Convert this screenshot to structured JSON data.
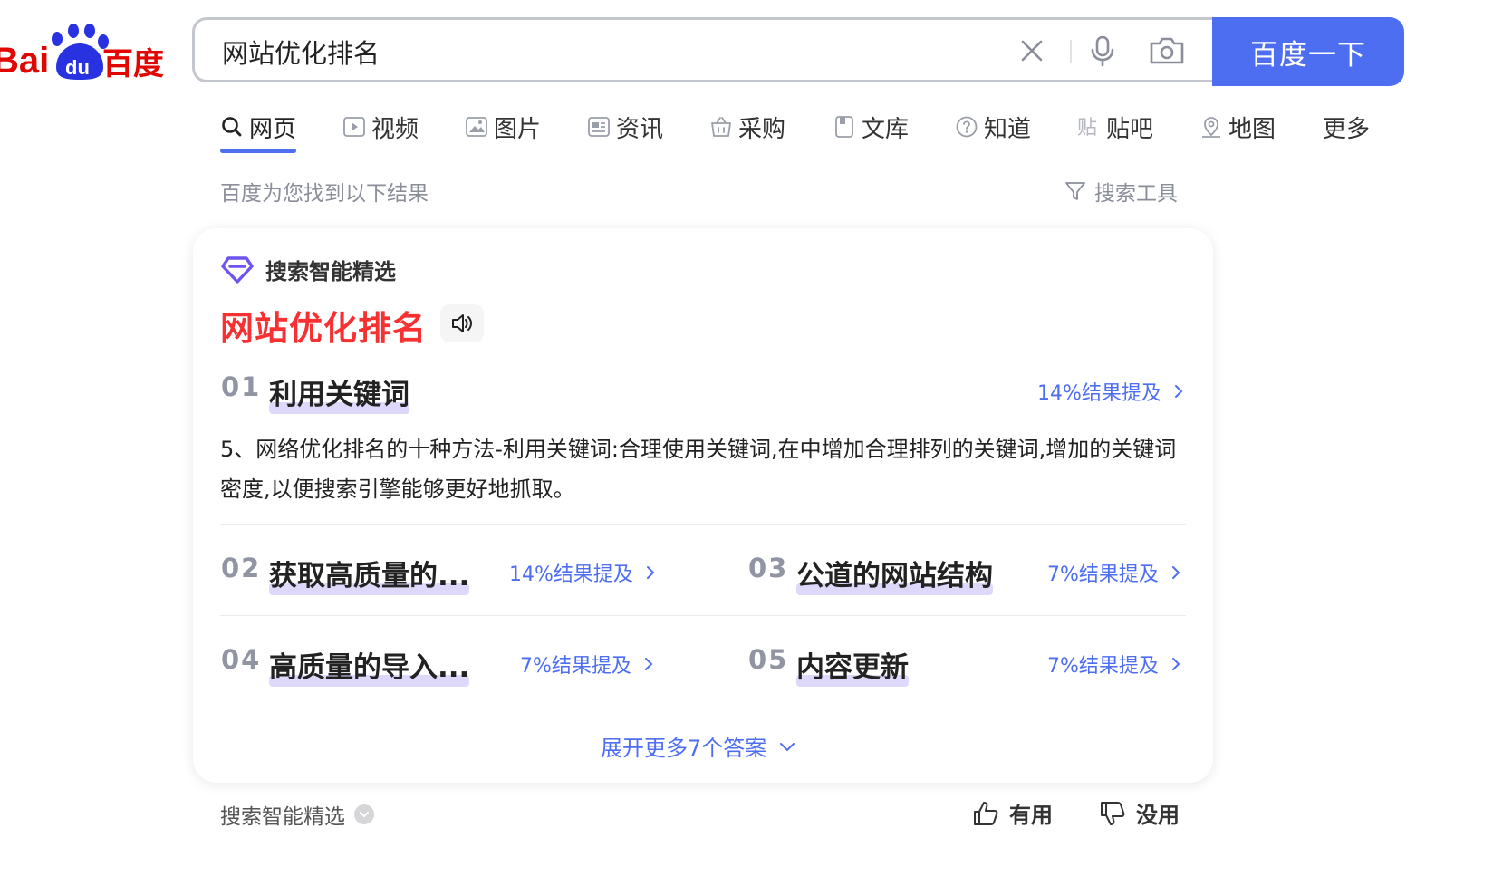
{
  "logo": {
    "text_bai": "Bai",
    "text_du": "du",
    "text_cn": "百度"
  },
  "search": {
    "query": "网站优化排名",
    "button_label": "百度一下"
  },
  "tabs": [
    {
      "label": "网页",
      "icon": "search-icon"
    },
    {
      "label": "视频",
      "icon": "video-icon"
    },
    {
      "label": "图片",
      "icon": "image-icon"
    },
    {
      "label": "资讯",
      "icon": "news-icon"
    },
    {
      "label": "采购",
      "icon": "basket-icon"
    },
    {
      "label": "文库",
      "icon": "document-icon"
    },
    {
      "label": "知道",
      "icon": "question-icon"
    },
    {
      "label": "贴吧",
      "icon": "tieba-icon"
    },
    {
      "label": "地图",
      "icon": "map-icon"
    },
    {
      "label": "更多",
      "icon": ""
    }
  ],
  "results": {
    "count_text": "百度为您找到以下结果",
    "tools_label": "搜索工具"
  },
  "card": {
    "label": "搜索智能精选",
    "title": "网站优化排名",
    "items": [
      {
        "num": "01",
        "title": "利用关键词",
        "mention": "14%结果提及",
        "text": "5、网络优化排名的十种方法-利用关键词:合理使用关键词,在中增加合理排列的关键词,增加的关键词密度,以便搜索引擎能够更好地抓取。"
      },
      {
        "num": "02",
        "title": "获取高质量的...",
        "mention": "14%结果提及"
      },
      {
        "num": "03",
        "title": "公道的网站结构",
        "mention": "7%结果提及"
      },
      {
        "num": "04",
        "title": "高质量的导入...",
        "mention": "7%结果提及"
      },
      {
        "num": "05",
        "title": "内容更新",
        "mention": "7%结果提及"
      }
    ],
    "expand_label": "展开更多7个答案"
  },
  "footer": {
    "label": "搜索智能精选",
    "useful": "有用",
    "useless": "没用"
  },
  "colors": {
    "brand_blue": "#4e6ef2",
    "title_red": "#f73131",
    "logo_blue": "#2932e1",
    "logo_red": "#e10602",
    "highlight": "#ded8fb"
  }
}
